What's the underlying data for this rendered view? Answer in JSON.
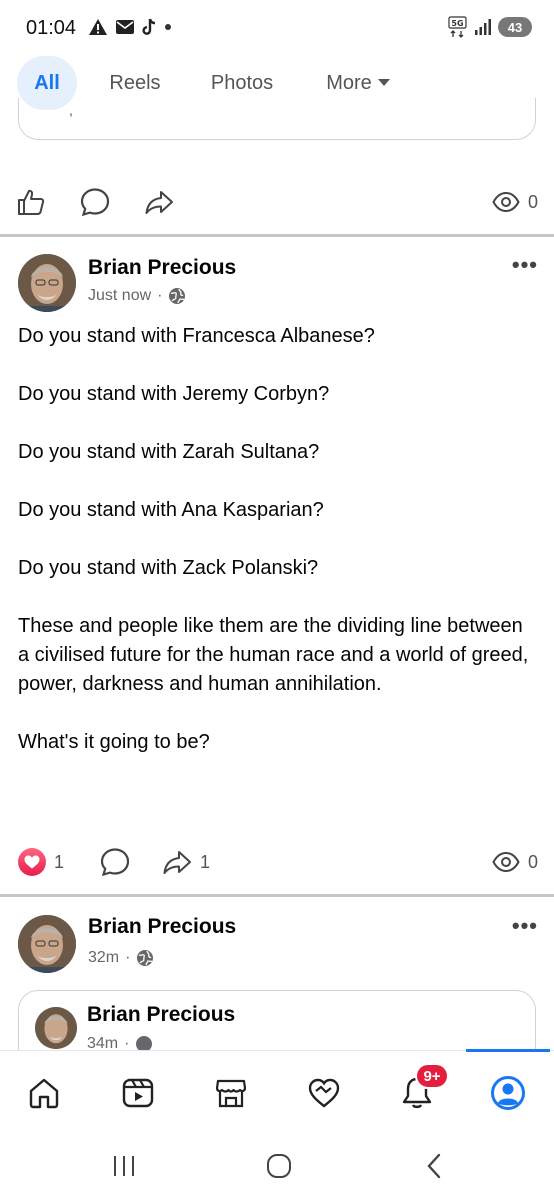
{
  "status_bar": {
    "time": "01:04",
    "battery": "43",
    "network": "5G"
  },
  "tabs": [
    {
      "label": "All",
      "active": true
    },
    {
      "label": "Reels"
    },
    {
      "label": "Photos"
    },
    {
      "label": "More"
    }
  ],
  "top_post_actions": {
    "views": "0"
  },
  "post": {
    "author": "Brian Precious",
    "time": "Just now",
    "paragraphs": [
      "Do you stand with Francesca Albanese?",
      "Do you stand with Jeremy Corbyn?",
      "Do you stand with Zarah Sultana?",
      "Do you stand with Ana Kasparian?",
      "Do you stand with Zack Polanski?",
      "These and people like them are the dividing line between a civilised future for the human race and a world of greed, power, darkness and human annihilation.",
      "What's it going to be?"
    ],
    "reactions": "1",
    "shares": "1",
    "views": "0"
  },
  "second_post": {
    "author": "Brian Precious",
    "time": "32m",
    "shared_author": "Brian Precious",
    "shared_time": "34m"
  },
  "bottom_nav": {
    "notification_badge": "9+"
  },
  "colors": {
    "accent": "#1877f2",
    "like_red": "#e61e4d",
    "divider": "#c4c6c9"
  }
}
